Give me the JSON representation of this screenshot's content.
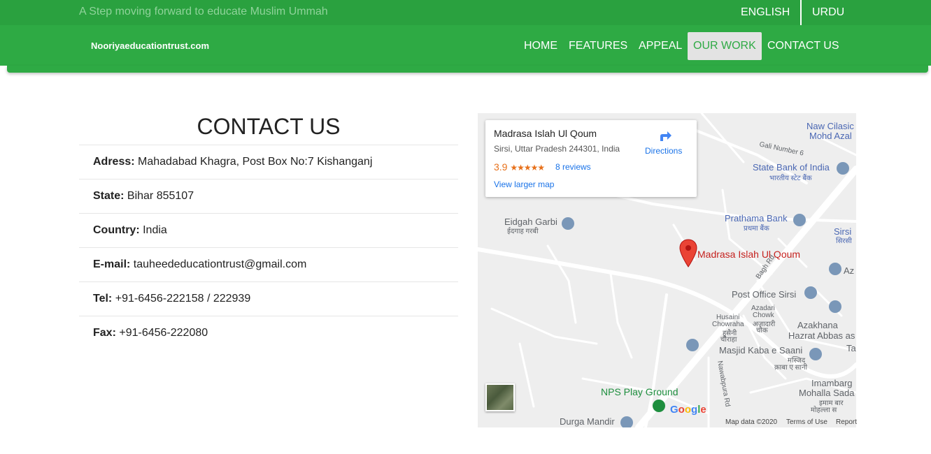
{
  "topbar": {
    "tagline": "A Step moving forward to educate Muslim Ummah",
    "languages": [
      "ENGLISH",
      "URDU"
    ]
  },
  "navbar": {
    "brand": "Nooriyaeducationtrust.com",
    "links": [
      "HOME",
      "FEATURES",
      "APPEAL",
      "OUR WORK",
      "CONTACT US"
    ],
    "active": "OUR WORK"
  },
  "contact": {
    "title": "CONTACT US",
    "rows": [
      {
        "label": "Adress:",
        "value": "Mahadabad Khagra, Post Box No:7 Kishanganj"
      },
      {
        "label": "State:",
        "value": "Bihar 855107"
      },
      {
        "label": "Country:",
        "value": "India"
      },
      {
        "label": "E-mail:",
        "value": "tauheededucationtrust@gmail.com"
      },
      {
        "label": "Tel:",
        "value": "+91-6456-222158 / 222939"
      },
      {
        "label": "Fax:",
        "value": "+91-6456-222080"
      }
    ]
  },
  "map": {
    "card": {
      "title": "Madrasa Islah Ul Qoum",
      "address": "Sirsi, Uttar Pradesh 244301, India",
      "rating": "3.9",
      "stars": "★★★★★",
      "reviews": "8 reviews",
      "larger_map": "View larger map",
      "directions": "Directions"
    },
    "places": {
      "naw_cilasic": "Naw Cilasic",
      "mohd_azal": "Mohd Azal",
      "gali_number": "Gali Number 6",
      "state_bank": "State Bank of India",
      "state_bank_hi": "भारतीय स्टेट बैंक",
      "eidgah": "Eidgah Garbi",
      "eidgah_hi": "ईदगाह गरबी",
      "prathama": "Prathama Bank",
      "prathama_hi": "प्रथमा बैंक",
      "sirsi": "Sirsi",
      "sirsi_hi": "सिरसी",
      "madrasa_pin": "Madrasa Islah Ul Qoum",
      "az": "Az",
      "bagh_rd": "Bagh Rd",
      "post_office": "Post Office Sirsi",
      "husaini": "Husaini",
      "chowraha": "Chowraha",
      "husaini_hi1": "हुसैनी",
      "husaini_hi2": "चौराहा",
      "azadari": "Azadari",
      "chowk": "Chowk",
      "azadari_hi1": "अज़ादारी",
      "azadari_hi2": "चौक",
      "azakhana": "Azakhana",
      "hazrat": "Hazrat Abbas as",
      "ta": "Ta",
      "masjid": "Masjid Kaba e Saani",
      "masjid_hi1": "मस्जिद",
      "masjid_hi2": "क़ाबा ए सानी",
      "imambarg": "Imambarg",
      "mohalla": "Mohalla Sada",
      "imam_hi1": "इमाम बार",
      "imam_hi2": "मोहल्ला स",
      "nps": "NPS Play Ground",
      "durga": "Durga Mandir",
      "nawabpura_rd": "Nawabpura Rd"
    },
    "google": "Google",
    "footer": {
      "map_data": "Map data ©2020",
      "terms": "Terms of Use",
      "report": "Report"
    },
    "colors": {
      "pin": "#ea4335",
      "nps": "#1e8e3e"
    }
  }
}
